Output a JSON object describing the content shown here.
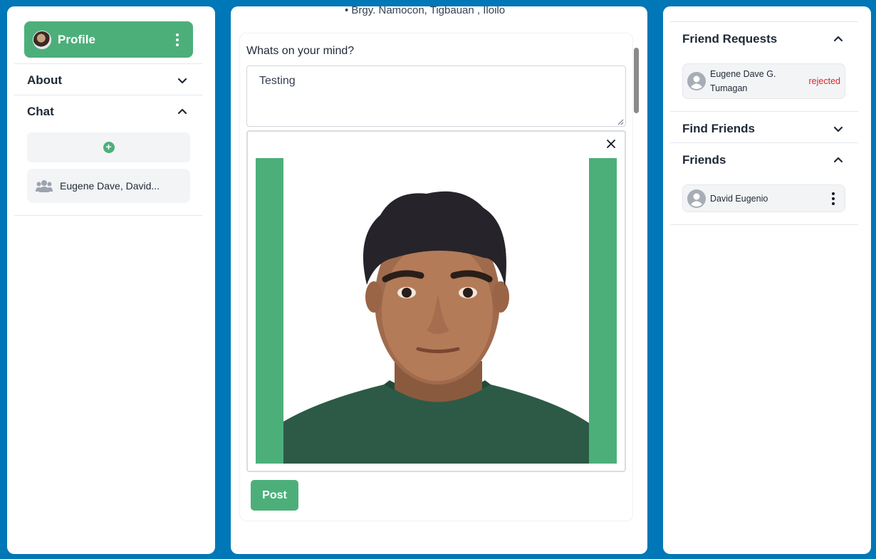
{
  "left": {
    "profile_label": "Profile",
    "sections": {
      "about": "About",
      "chat": "Chat"
    },
    "chats": [
      {
        "name": "Eugene Dave, David..."
      }
    ]
  },
  "center": {
    "location_text": "Brgy. Namocon, Tigbauan , Iloilo",
    "prompt_label": "Whats on your mind?",
    "post_text": "Testing",
    "post_button": "Post"
  },
  "right": {
    "friend_requests_title": "Friend Requests",
    "requests": [
      {
        "name_line1": "Eugene Dave G.",
        "name_line2": "Tumagan",
        "status": "rejected"
      }
    ],
    "find_friends_title": "Find Friends",
    "friends_title": "Friends",
    "friends": [
      {
        "name": "David Eugenio"
      }
    ]
  },
  "colors": {
    "background": "#0077b6",
    "accent": "#4caf7a",
    "rejected": "#dc2626"
  },
  "icons": [
    "kebab-icon",
    "chevron-down-icon",
    "chevron-up-icon",
    "plus-icon",
    "group-icon",
    "close-icon",
    "user-icon"
  ]
}
